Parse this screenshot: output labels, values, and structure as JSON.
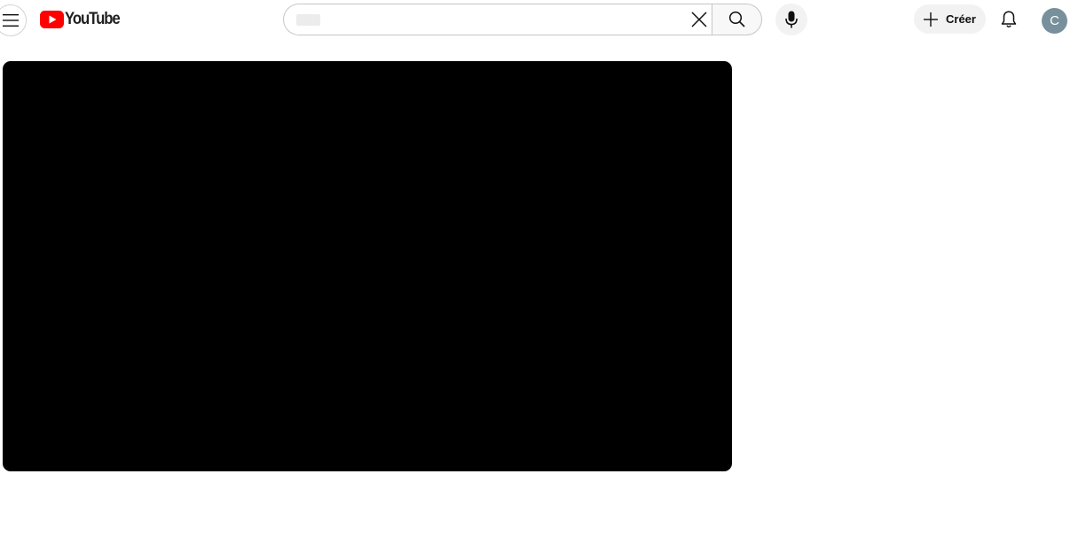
{
  "header": {
    "logo_text": "YouTube",
    "search": {
      "value": "",
      "placeholder": ""
    },
    "create_label": "Créer",
    "avatar_letter": "C"
  },
  "colors": {
    "brand_red": "#ff0000",
    "avatar_bg": "#78909c",
    "player_bg": "#000000"
  },
  "icons": {
    "menu": "hamburger-menu-icon",
    "logo": "youtube-play-icon",
    "clear": "close-icon",
    "search": "search-icon",
    "mic": "microphone-icon",
    "create": "plus-icon",
    "notifications": "bell-icon"
  }
}
